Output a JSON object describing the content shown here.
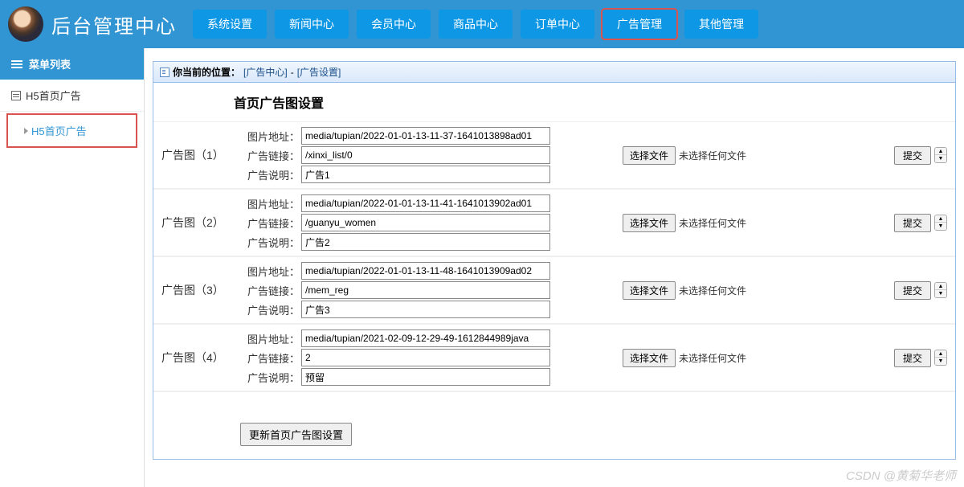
{
  "header": {
    "title": "后台管理中心",
    "nav": [
      {
        "label": "系统设置"
      },
      {
        "label": "新闻中心"
      },
      {
        "label": "会员中心"
      },
      {
        "label": "商品中心"
      },
      {
        "label": "订单中心"
      },
      {
        "label": "广告管理",
        "highlighted": true
      },
      {
        "label": "其他管理"
      }
    ]
  },
  "sidebar": {
    "menu_title": "菜单列表",
    "category": "H5首页广告",
    "link": {
      "label": "H5首页广告",
      "highlighted": true
    }
  },
  "breadcrumb": {
    "prefix": "你当前的位置：",
    "path1": "[广告中心]",
    "sep": "-",
    "path2": "[广告设置]"
  },
  "page": {
    "section_title": "首页广告图设置",
    "labels": {
      "image_addr": "图片地址：",
      "ad_link": "广告链接：",
      "ad_desc": "广告说明：",
      "choose_file": "选择文件",
      "no_file": "未选择任何文件",
      "submit": "提交",
      "update_btn": "更新首页广告图设置"
    },
    "rows": [
      {
        "title": "广告图（1）",
        "image": "media/tupian/2022-01-01-13-11-37-1641013898ad01",
        "link": "/xinxi_list/0",
        "desc": "广告1"
      },
      {
        "title": "广告图（2）",
        "image": "media/tupian/2022-01-01-13-11-41-1641013902ad01",
        "link": "/guanyu_women",
        "desc": "广告2"
      },
      {
        "title": "广告图（3）",
        "image": "media/tupian/2022-01-01-13-11-48-1641013909ad02",
        "link": "/mem_reg",
        "desc": "广告3"
      },
      {
        "title": "广告图（4）",
        "image": "media/tupian/2021-02-09-12-29-49-1612844989java",
        "link": "2",
        "desc": "预留"
      }
    ]
  },
  "watermark": "CSDN @黄菊华老师"
}
